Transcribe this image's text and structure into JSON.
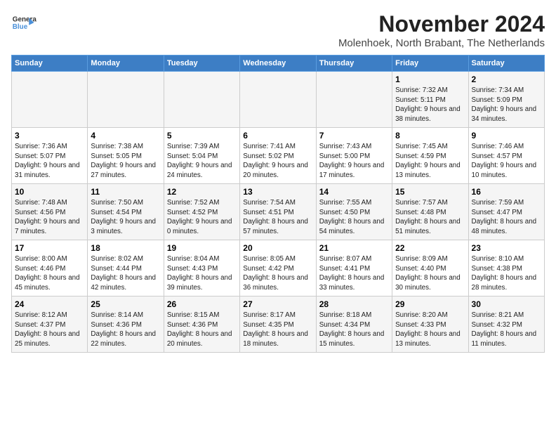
{
  "logo": {
    "line1": "General",
    "line2": "Blue"
  },
  "title": "November 2024",
  "location": "Molenhoek, North Brabant, The Netherlands",
  "weekdays": [
    "Sunday",
    "Monday",
    "Tuesday",
    "Wednesday",
    "Thursday",
    "Friday",
    "Saturday"
  ],
  "weeks": [
    [
      {
        "day": "",
        "info": ""
      },
      {
        "day": "",
        "info": ""
      },
      {
        "day": "",
        "info": ""
      },
      {
        "day": "",
        "info": ""
      },
      {
        "day": "",
        "info": ""
      },
      {
        "day": "1",
        "info": "Sunrise: 7:32 AM\nSunset: 5:11 PM\nDaylight: 9 hours\nand 38 minutes."
      },
      {
        "day": "2",
        "info": "Sunrise: 7:34 AM\nSunset: 5:09 PM\nDaylight: 9 hours\nand 34 minutes."
      }
    ],
    [
      {
        "day": "3",
        "info": "Sunrise: 7:36 AM\nSunset: 5:07 PM\nDaylight: 9 hours\nand 31 minutes."
      },
      {
        "day": "4",
        "info": "Sunrise: 7:38 AM\nSunset: 5:05 PM\nDaylight: 9 hours\nand 27 minutes."
      },
      {
        "day": "5",
        "info": "Sunrise: 7:39 AM\nSunset: 5:04 PM\nDaylight: 9 hours\nand 24 minutes."
      },
      {
        "day": "6",
        "info": "Sunrise: 7:41 AM\nSunset: 5:02 PM\nDaylight: 9 hours\nand 20 minutes."
      },
      {
        "day": "7",
        "info": "Sunrise: 7:43 AM\nSunset: 5:00 PM\nDaylight: 9 hours\nand 17 minutes."
      },
      {
        "day": "8",
        "info": "Sunrise: 7:45 AM\nSunset: 4:59 PM\nDaylight: 9 hours\nand 13 minutes."
      },
      {
        "day": "9",
        "info": "Sunrise: 7:46 AM\nSunset: 4:57 PM\nDaylight: 9 hours\nand 10 minutes."
      }
    ],
    [
      {
        "day": "10",
        "info": "Sunrise: 7:48 AM\nSunset: 4:56 PM\nDaylight: 9 hours\nand 7 minutes."
      },
      {
        "day": "11",
        "info": "Sunrise: 7:50 AM\nSunset: 4:54 PM\nDaylight: 9 hours\nand 3 minutes."
      },
      {
        "day": "12",
        "info": "Sunrise: 7:52 AM\nSunset: 4:52 PM\nDaylight: 9 hours\nand 0 minutes."
      },
      {
        "day": "13",
        "info": "Sunrise: 7:54 AM\nSunset: 4:51 PM\nDaylight: 8 hours\nand 57 minutes."
      },
      {
        "day": "14",
        "info": "Sunrise: 7:55 AM\nSunset: 4:50 PM\nDaylight: 8 hours\nand 54 minutes."
      },
      {
        "day": "15",
        "info": "Sunrise: 7:57 AM\nSunset: 4:48 PM\nDaylight: 8 hours\nand 51 minutes."
      },
      {
        "day": "16",
        "info": "Sunrise: 7:59 AM\nSunset: 4:47 PM\nDaylight: 8 hours\nand 48 minutes."
      }
    ],
    [
      {
        "day": "17",
        "info": "Sunrise: 8:00 AM\nSunset: 4:46 PM\nDaylight: 8 hours\nand 45 minutes."
      },
      {
        "day": "18",
        "info": "Sunrise: 8:02 AM\nSunset: 4:44 PM\nDaylight: 8 hours\nand 42 minutes."
      },
      {
        "day": "19",
        "info": "Sunrise: 8:04 AM\nSunset: 4:43 PM\nDaylight: 8 hours\nand 39 minutes."
      },
      {
        "day": "20",
        "info": "Sunrise: 8:05 AM\nSunset: 4:42 PM\nDaylight: 8 hours\nand 36 minutes."
      },
      {
        "day": "21",
        "info": "Sunrise: 8:07 AM\nSunset: 4:41 PM\nDaylight: 8 hours\nand 33 minutes."
      },
      {
        "day": "22",
        "info": "Sunrise: 8:09 AM\nSunset: 4:40 PM\nDaylight: 8 hours\nand 30 minutes."
      },
      {
        "day": "23",
        "info": "Sunrise: 8:10 AM\nSunset: 4:38 PM\nDaylight: 8 hours\nand 28 minutes."
      }
    ],
    [
      {
        "day": "24",
        "info": "Sunrise: 8:12 AM\nSunset: 4:37 PM\nDaylight: 8 hours\nand 25 minutes."
      },
      {
        "day": "25",
        "info": "Sunrise: 8:14 AM\nSunset: 4:36 PM\nDaylight: 8 hours\nand 22 minutes."
      },
      {
        "day": "26",
        "info": "Sunrise: 8:15 AM\nSunset: 4:36 PM\nDaylight: 8 hours\nand 20 minutes."
      },
      {
        "day": "27",
        "info": "Sunrise: 8:17 AM\nSunset: 4:35 PM\nDaylight: 8 hours\nand 18 minutes."
      },
      {
        "day": "28",
        "info": "Sunrise: 8:18 AM\nSunset: 4:34 PM\nDaylight: 8 hours\nand 15 minutes."
      },
      {
        "day": "29",
        "info": "Sunrise: 8:20 AM\nSunset: 4:33 PM\nDaylight: 8 hours\nand 13 minutes."
      },
      {
        "day": "30",
        "info": "Sunrise: 8:21 AM\nSunset: 4:32 PM\nDaylight: 8 hours\nand 11 minutes."
      }
    ]
  ]
}
